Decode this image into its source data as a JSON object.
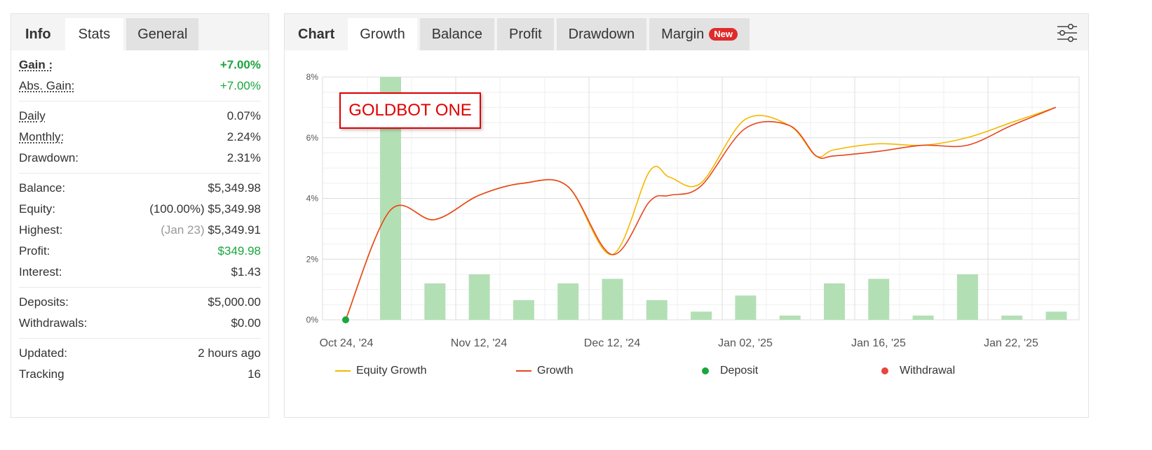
{
  "left": {
    "tabs": [
      "Info",
      "Stats",
      "General"
    ],
    "gain": {
      "label": "Gain :",
      "value": "+7.00%"
    },
    "abs_gain": {
      "label": "Abs. Gain:",
      "value": "+7.00%"
    },
    "daily": {
      "label": "Daily",
      "value": "0.07%"
    },
    "monthly": {
      "label": "Monthly:",
      "value": "2.24%"
    },
    "drawdown": {
      "label": "Drawdown:",
      "value": "2.31%"
    },
    "balance": {
      "label": "Balance:",
      "value": "$5,349.98"
    },
    "equity": {
      "label": "Equity:",
      "prefix": "(100.00%)",
      "value": "$5,349.98"
    },
    "highest": {
      "label": "Highest:",
      "prefix": "(Jan 23)",
      "value": "$5,349.91"
    },
    "profit": {
      "label": "Profit:",
      "value": "$349.98"
    },
    "interest": {
      "label": "Interest:",
      "value": "$1.43"
    },
    "deposits": {
      "label": "Deposits:",
      "value": "$5,000.00"
    },
    "withdrawals": {
      "label": "Withdrawals:",
      "value": "$0.00"
    },
    "updated": {
      "label": "Updated:",
      "value": "2 hours ago"
    },
    "tracking": {
      "label": "Tracking",
      "value": "16"
    }
  },
  "right": {
    "tabs": [
      "Chart",
      "Growth",
      "Balance",
      "Profit",
      "Drawdown",
      "Margin"
    ],
    "new_badge": "New",
    "overlay_label": "GOLDBOT ONE",
    "legend": [
      "Equity Growth",
      "Growth",
      "Deposit",
      "Withdrawal"
    ]
  },
  "colors": {
    "equity_growth": "#f5b800",
    "growth": "#e8451e",
    "deposit": "#1aa53d",
    "withdrawal": "#e8453c",
    "bars": "#b3dfb5",
    "positive": "#1aa53d"
  },
  "chart_data": {
    "type": "line",
    "ylim": [
      0,
      8
    ],
    "y_ticks": [
      "0%",
      "2%",
      "4%",
      "6%",
      "8%"
    ],
    "x_tick_labels": [
      "Oct 24, '24",
      "Nov 12, '24",
      "Dec 12, '24",
      "Jan 02, '25",
      "Jan 16, '25",
      "Jan 22, '25"
    ],
    "bars": [
      8.0,
      1.2,
      1.5,
      0.65,
      1.2,
      1.35,
      0.65,
      0.27,
      0.8,
      0.14,
      1.2,
      1.35,
      0.14,
      1.5,
      0.14,
      0.27
    ],
    "series": [
      {
        "name": "Equity Growth",
        "x": [
          0,
          1,
          2,
          3,
          4,
          5,
          6,
          6.85,
          7.3,
          8,
          9,
          10,
          10.6,
          11,
          12,
          13,
          14,
          15,
          16
        ],
        "values": [
          0,
          3.6,
          3.3,
          4.1,
          4.5,
          4.4,
          2.15,
          4.9,
          4.7,
          4.5,
          6.6,
          6.4,
          5.4,
          5.6,
          5.8,
          5.75,
          6.0,
          6.5,
          7.0
        ]
      },
      {
        "name": "Growth",
        "x": [
          0,
          1,
          2,
          3,
          4,
          5,
          6,
          6.85,
          7.3,
          8,
          9,
          10,
          10.6,
          11,
          12,
          13,
          14,
          15,
          16
        ],
        "values": [
          0,
          3.6,
          3.3,
          4.1,
          4.5,
          4.4,
          2.15,
          3.9,
          4.1,
          4.4,
          6.3,
          6.4,
          5.4,
          5.4,
          5.55,
          5.75,
          5.75,
          6.4,
          7.0
        ]
      }
    ],
    "deposit_points": [
      {
        "x": 0,
        "y": 0
      }
    ]
  }
}
